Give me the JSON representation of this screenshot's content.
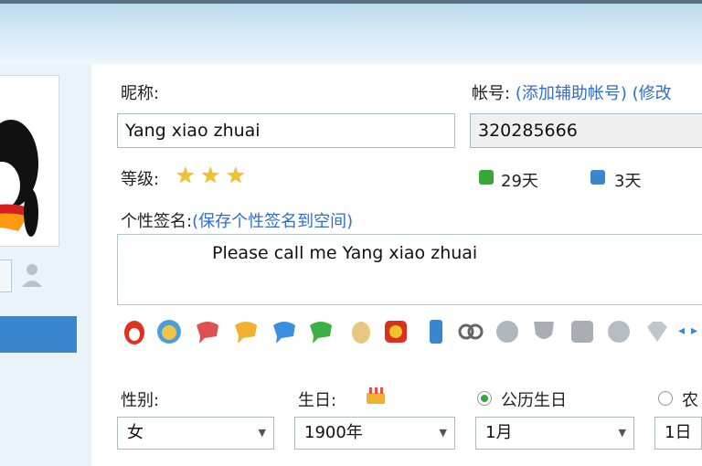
{
  "colors": {
    "link": "#2f6fc8",
    "selected": "#3b87cf"
  },
  "profile": {
    "nickname_label": "昵称:",
    "nickname_value": "Yang xiao zhuai",
    "account_label": "帐号:",
    "account_link_add": "(添加辅助帐号)",
    "account_link_modify": "(修改",
    "account_value": "320285666",
    "level_label": "等级:",
    "active_days": "29天",
    "upgrade_days": "3天",
    "signature_label": "个性签名:",
    "signature_link": "(保存个性签名到空间)",
    "signature_value": "Please call me Yang xiao zhuai",
    "gender_label": "性别:",
    "gender_value": "女",
    "birthday_label": "生日:",
    "birth_year": "1900年",
    "solar_label": "公历生日",
    "lunar_label": "农",
    "birth_month": "1月",
    "birth_day": "1日"
  },
  "icons": {
    "stars": [
      "star-icon",
      "star-icon",
      "star-icon"
    ],
    "badges": [
      "qq-icon",
      "face-icon",
      "chat-icon",
      "chat-icon",
      "chat-icon",
      "chat-icon",
      "egg-icon",
      "qq-show-icon",
      "phone-icon",
      "link-icon",
      "medal-icon",
      "shield-icon",
      "photo-icon",
      "clock-icon",
      "diamond-icon"
    ]
  }
}
